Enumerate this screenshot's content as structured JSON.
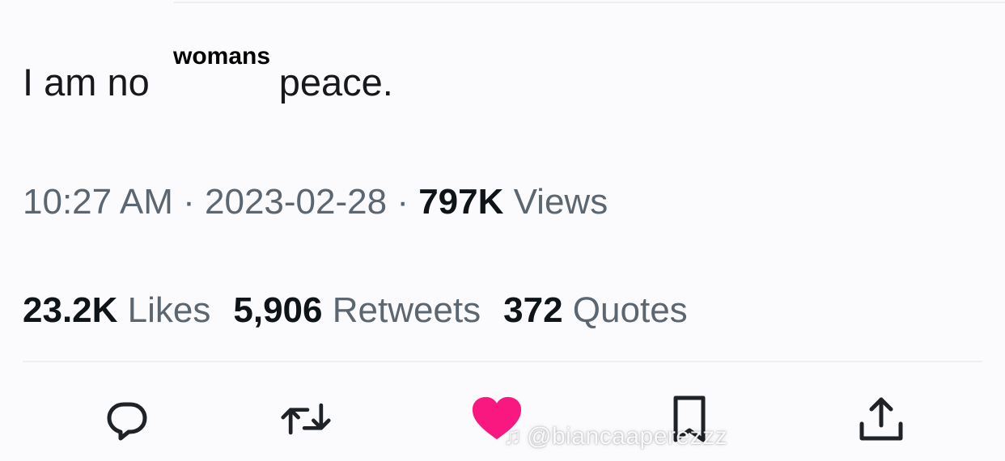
{
  "tweet": {
    "text_before": "I am no",
    "text_after": "peace.",
    "overlay_word": "womans"
  },
  "meta": {
    "time": "10:27 AM",
    "separator": " · ",
    "date": "2023-02-28",
    "views_count": "797K",
    "views_label": "Views"
  },
  "stats": {
    "likes_count": "23.2K",
    "likes_label": "Likes",
    "retweets_count": "5,906",
    "retweets_label": "Retweets",
    "quotes_count": "372",
    "quotes_label": "Quotes"
  },
  "actions": [
    {
      "name": "reply-icon"
    },
    {
      "name": "retweet-icon"
    },
    {
      "name": "like-heart-icon",
      "state": "liked"
    },
    {
      "name": "bookmark-icon"
    },
    {
      "name": "share-icon"
    }
  ],
  "colors": {
    "text": "#0f1419",
    "secondary": "#5b6670",
    "like": "#f91880",
    "icon": "#1f2328"
  },
  "watermark": {
    "icon": "tiktok-icon",
    "text": "@biancaaperezzz"
  }
}
